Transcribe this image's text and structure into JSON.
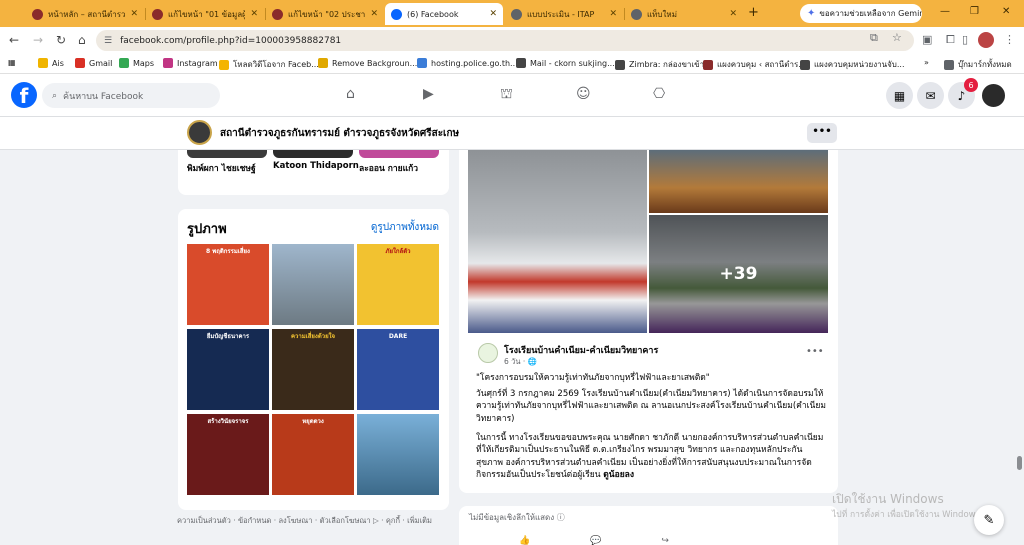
{
  "browser": {
    "tabs": [
      {
        "title": "หน้าหลัก – สถานีตำรวจภ",
        "active": false,
        "favicon_color": "#8a2b2b"
      },
      {
        "title": "แก้ไขหน้า \"01 ข้อมูลผู้บร",
        "active": false,
        "favicon_color": "#8a2b2b"
      },
      {
        "title": "แก้ไขหน้า \"02 ประชาสัมพั",
        "active": false,
        "favicon_color": "#8a2b2b"
      },
      {
        "title": "(6) Facebook",
        "active": true,
        "favicon_color": "#0866ff"
      },
      {
        "title": "แบบประเมิน - ITAP",
        "active": false,
        "favicon_color": "#5f6368"
      },
      {
        "title": "แท็บใหม่",
        "active": false,
        "favicon_color": "#5f6368"
      }
    ],
    "new_tab": "+",
    "gemini_label": "ขอความช่วยเหลือจาก Gemini",
    "url": "facebook.com/profile.php?id=100003958882781",
    "window_controls": [
      "—",
      "❐",
      "✕"
    ],
    "bookmarks": [
      {
        "label": "Ais",
        "color": "#f0b400"
      },
      {
        "label": "Gmail",
        "color": "#d93025"
      },
      {
        "label": "Maps",
        "color": "#34a853"
      },
      {
        "label": "Instagram",
        "color": "#c13584"
      },
      {
        "label": "โหลดวิดีโอจาก Faceb...",
        "color": "#f4b400"
      },
      {
        "label": "Remove Backgroun...",
        "color": "#e0a800"
      },
      {
        "label": "hosting.police.go.th...",
        "color": "#3b7dd8"
      },
      {
        "label": "Mail - ckorn sukjing...",
        "color": "#444444"
      },
      {
        "label": "Zimbra: กล่องขาเข้า",
        "color": "#444444"
      },
      {
        "label": "แผงควบคุม ‹ สถานีตำร...",
        "color": "#8a2b2b"
      },
      {
        "label": "แผงควบคุมหน่วยงานจับ...",
        "color": "#444444"
      }
    ],
    "bookmarks_overflow": "»",
    "all_bookmarks": "บุ๊กมาร์กทั้งหมด"
  },
  "facebook": {
    "logo": "f",
    "search_placeholder": "ค้นหาบน Facebook",
    "notification_count": "6",
    "brand_color": "#0866ff"
  },
  "page": {
    "name": "สถานีตำรวจภูธรกันทรารมย์ ตำรวจภูธรจังหวัดศรีสะเกษ",
    "more": "•••"
  },
  "friends": [
    {
      "name": "พิมพ์ผกา ไชยเชษฐ์"
    },
    {
      "name": "Katoon Thidaporn"
    },
    {
      "name": "ละออน กายแก้ว"
    }
  ],
  "photos": {
    "title": "รูปภาพ",
    "see_all": "ดูรูปภาพทั้งหมด",
    "items": [
      {
        "caption": "8 พฤติกรรมเสี่ยง",
        "color": "#d94b2b"
      },
      {
        "caption": "",
        "color": "#7c8fa3"
      },
      {
        "caption": "ภัยใกล้ตัว",
        "color": "#f2c230"
      },
      {
        "caption": "ยืมบัญชีธนาคาร",
        "color": "#152a52"
      },
      {
        "caption": "ความเสี่ยงด้วยใจ",
        "color": "#3a2a1a"
      },
      {
        "caption": "DARE",
        "color": "#2e4fa0"
      },
      {
        "caption": "สร้างวินัยจราจร",
        "color": "#6a1a1a"
      },
      {
        "caption": "หยุดดวง",
        "color": "#b83a1a"
      },
      {
        "caption": "",
        "color": "#3c6a8a"
      }
    ]
  },
  "footer_links": "ความเป็นส่วนตัว · ข้อกำหนด · ลงโฆษณา · ตัวเลือกโฆษณา ▷ · คุกกี้ · เพิ่มเติม",
  "post": {
    "author": "โรงเรียนบ้านคำเนียม-คำเนียมวิทยาคาร",
    "meta": "6 วัน · 🌐",
    "more_photos": "+39",
    "title": "\"โครงการอบรมให้ความรู้เท่าทันภัยจากบุหรี่ไฟฟ้าและยาเสพติด\"",
    "paragraph1": "วันศุกร์ที่ 3 กรกฎาคม 2569 โรงเรียนบ้านคำเนียม(คำเนียมวิทยาคาร) ได้ดำเนินการจัดอบรมให้ความรู้เท่าทันภัยจากบุหรี่ไฟฟ้าและยาเสพติด ณ ลานอเนกประสงค์โรงเรียนบ้านคำเนียม(คำเนียมวิทยาคาร)",
    "paragraph2": "ในการนี้ ทางโรงเรียนขอขอบพระคุณ นายศักดา ชาภักดี นายกองค์การบริหารส่วนตำบลคำเนียมที่ให้เกียรติมาเป็นประธานในพิธี ด.ต.เกรียงไกร พรมมาสุข วิทยากร และกองทุนหลักประกันสุขภาพ องค์การบริหารส่วนตำบลคำเนียม เป็นอย่างยิ่งที่ให้การสนับสนุนงบประมาณในการจัดกิจกรรมอันเป็นประโยชน์ต่อผู้เรียน",
    "see_more": "ดูน้อยลง"
  },
  "no_data": "ไม่มีข้อมูลเชิงลึกให้แสดง",
  "watermark": {
    "line1": "เปิดใช้งาน Windows",
    "line2": "ไปที่ การตั้งค่า เพื่อเปิดใช้งาน Windows"
  }
}
